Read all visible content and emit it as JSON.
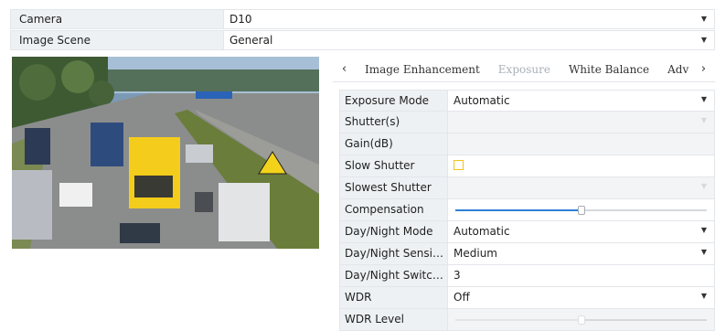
{
  "camera": {
    "label": "Camera",
    "value": "D10"
  },
  "image_scene": {
    "label": "Image Scene",
    "value": "General"
  },
  "tabs": [
    "Image Enhancement",
    "Exposure",
    "White Balance",
    "Adv"
  ],
  "settings": {
    "exposure_mode": {
      "label": "Exposure Mode",
      "value": "Automatic"
    },
    "shutter": {
      "label": "Shutter(s)",
      "value": ""
    },
    "gain": {
      "label": "Gain(dB)",
      "value": ""
    },
    "slow_shutter": {
      "label": "Slow Shutter",
      "checked": false
    },
    "slowest_shutter": {
      "label": "Slowest Shutter",
      "value": ""
    },
    "compensation": {
      "label": "Compensation",
      "level": 0.5
    },
    "day_night_mode": {
      "label": "Day/Night Mode",
      "value": "Automatic"
    },
    "day_night_sensitivity": {
      "label": "Day/Night Sensiti...",
      "value": "Medium"
    },
    "day_night_switch": {
      "label": "Day/Night Switch...",
      "value": "3"
    },
    "wdr": {
      "label": "WDR",
      "value": "Off"
    },
    "wdr_level": {
      "label": "WDR Level",
      "level": 0.5
    }
  },
  "colors": {
    "accent": "#2f7fd6",
    "checkbox": "#f0c419",
    "label_bg": "#eef1f4"
  }
}
